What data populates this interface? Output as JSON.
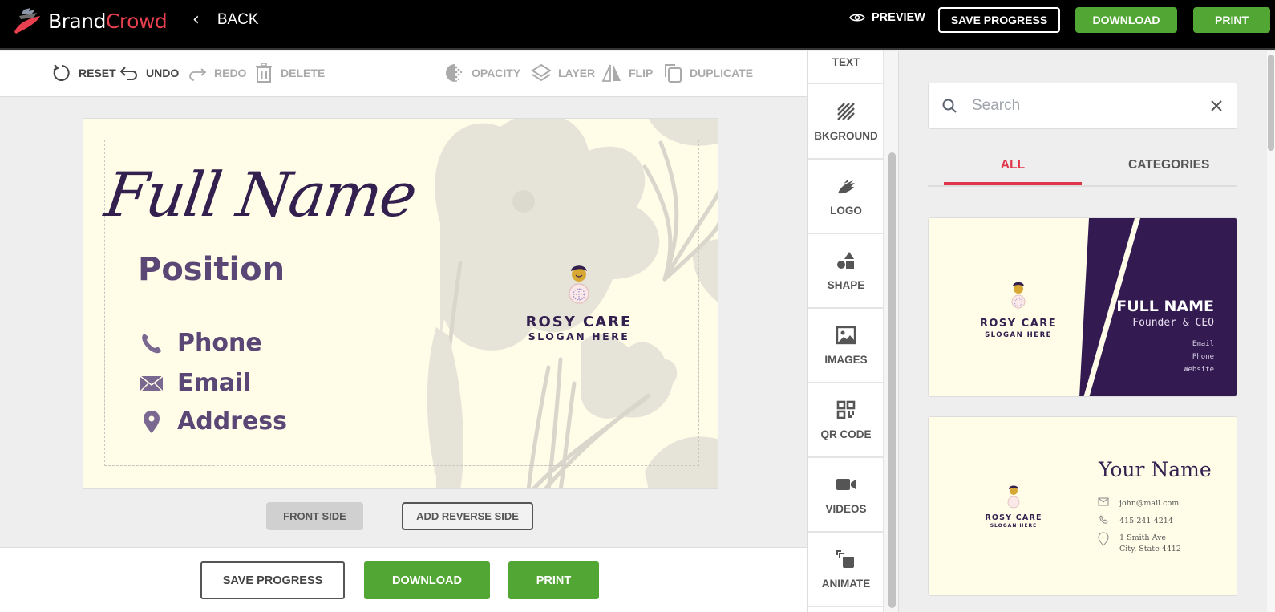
{
  "app": {
    "brand_part1": "Brand",
    "brand_part2": "Crowd",
    "back_label": "BACK"
  },
  "header": {
    "preview_label": "PREVIEW",
    "save_progress_label": "SAVE PROGRESS",
    "download_label": "DOWNLOAD",
    "print_label": "PRINT"
  },
  "toolbar": {
    "reset": "RESET",
    "undo": "UNDO",
    "redo": "REDO",
    "delete": "DELETE",
    "opacity": "OPACITY",
    "layer": "LAYER",
    "flip": "FLIP",
    "duplicate": "DUPLICATE"
  },
  "card": {
    "full_name": "Full Name",
    "position": "Position",
    "phone": "Phone",
    "email": "Email",
    "address": "Address",
    "company": "ROSY CARE",
    "slogan": "SLOGAN HERE",
    "text_color": "#33204f",
    "background_color": "#fffde8"
  },
  "sides": {
    "front_label": "FRONT SIDE",
    "reverse_label": "ADD REVERSE SIDE"
  },
  "bottom_bar": {
    "save_progress_label": "SAVE PROGRESS",
    "download_label": "DOWNLOAD",
    "print_label": "PRINT"
  },
  "tools_panel": {
    "items": [
      {
        "label": "TEXT",
        "icon": "text-icon"
      },
      {
        "label": "BKGROUND",
        "icon": "background-icon"
      },
      {
        "label": "LOGO",
        "icon": "logo-icon"
      },
      {
        "label": "SHAPE",
        "icon": "shape-icon"
      },
      {
        "label": "IMAGES",
        "icon": "image-icon"
      },
      {
        "label": "QR CODE",
        "icon": "qr-code-icon"
      },
      {
        "label": "VIDEOS",
        "icon": "video-icon"
      },
      {
        "label": "ANIMATE",
        "icon": "animate-icon"
      }
    ]
  },
  "right_panel": {
    "search_placeholder": "Search",
    "search_value": "",
    "tabs": [
      {
        "label": "ALL",
        "active": true
      },
      {
        "label": "CATEGORIES",
        "active": false
      }
    ],
    "templates": [
      {
        "company": "ROSY CARE",
        "slogan": "SLOGAN HERE",
        "name": "FULL NAME",
        "title": "Founder & CEO",
        "lines": [
          "Email",
          "Phone",
          "Website"
        ]
      },
      {
        "company": "ROSY CARE",
        "slogan": "SLOGAN HERE",
        "name": "Your Name",
        "email": "john@mail.com",
        "phone": "415-241-4214",
        "address_line1": "1 Smith Ave",
        "address_line2": "City, State 4412"
      }
    ]
  },
  "colors": {
    "accent_red": "#e0364a",
    "action_green": "#52a634",
    "brand_purple": "#33204f"
  }
}
